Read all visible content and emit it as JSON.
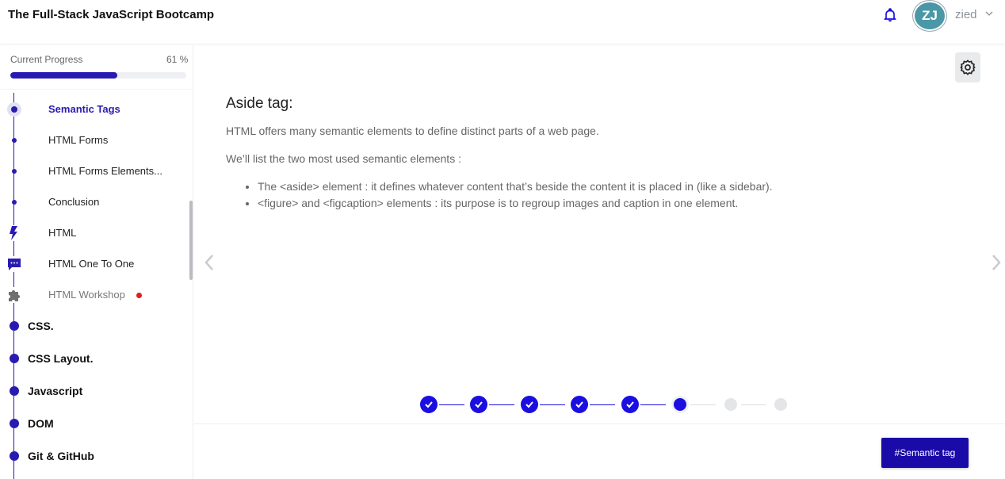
{
  "header": {
    "title": "The Full-Stack JavaScript Bootcamp",
    "avatar_initials": "ZJ",
    "username": "zied",
    "accent_color": "#1a0fe0"
  },
  "sidebar": {
    "progress_label": "Current Progress",
    "progress_percent": "61 %",
    "progress_value": 0.61,
    "items": [
      {
        "label": "Semantic Tags",
        "state": "active",
        "icon": "timeline-dot-active"
      },
      {
        "label": "HTML Forms",
        "state": "normal",
        "icon": "timeline-dot"
      },
      {
        "label": "HTML Forms Elements...",
        "state": "normal",
        "icon": "timeline-dot"
      },
      {
        "label": "Conclusion",
        "state": "normal",
        "icon": "timeline-dot"
      },
      {
        "label": "HTML",
        "state": "normal",
        "icon": "lightning-icon"
      },
      {
        "label": "HTML One To One",
        "state": "normal",
        "icon": "chat-bubble-icon"
      },
      {
        "label": "HTML Workshop",
        "state": "locked",
        "icon": "puzzle-icon",
        "badge": "red-dot"
      }
    ],
    "sections": [
      {
        "label": "CSS."
      },
      {
        "label": "CSS Layout."
      },
      {
        "label": "Javascript"
      },
      {
        "label": "DOM"
      },
      {
        "label": "Git & GitHub"
      }
    ]
  },
  "content": {
    "title": "Aside tag:",
    "para1": "HTML offers many semantic elements to define distinct parts of a web page.",
    "para2": "We’ll list the two most used semantic elements :",
    "bullets": [
      "The <aside> element : it defines whatever content that’s beside the content it is placed in (like a sidebar).",
      "<figure> and <figcaption> elements : its purpose is to regroup images and caption in one element."
    ]
  },
  "stepper": {
    "total": 8,
    "completed": 5,
    "current": 6
  },
  "footer": {
    "tag_button": "#Semantic tag"
  }
}
